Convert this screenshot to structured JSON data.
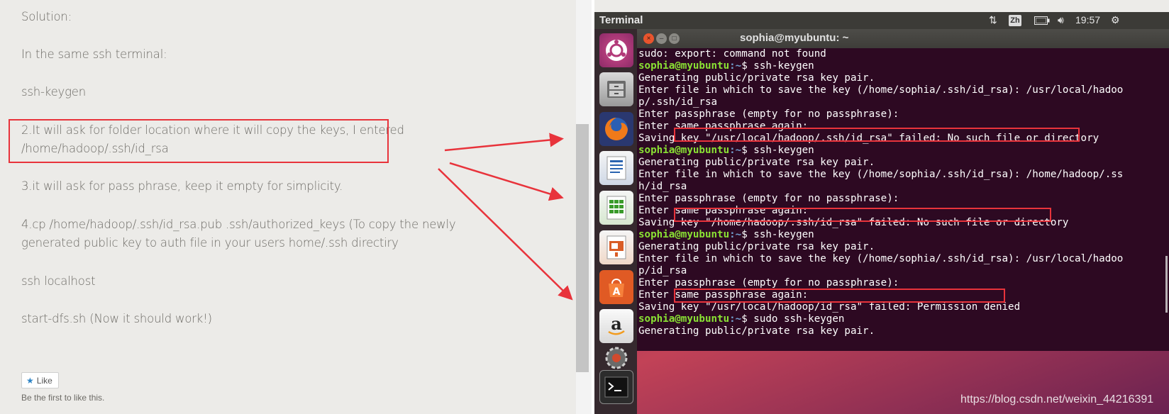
{
  "blog": {
    "lines": [
      "Solution:",
      "In the same ssh terminal:",
      "ssh-keygen",
      "2.It will ask for folder location where it will copy the keys, I entered",
      "/home/hadoop/.ssh/id_rsa",
      "3.it will ask for pass phrase, keep it empty for simplicity.",
      "4.cp /home/hadoop/.ssh/id_rsa.pub .ssh/authorized_keys (To copy the newly",
      "generated public key to auth file in your users home/.ssh directiry",
      "ssh localhost",
      "start-dfs.sh (Now it should work!)"
    ],
    "like_label": "Like",
    "like_note": "Be the first to like this."
  },
  "topbar": {
    "title": "Terminal",
    "lang": "Zh",
    "time": "19:57"
  },
  "launcher_icons": [
    "ubuntu-dash-icon",
    "files-icon",
    "firefox-icon",
    "writer-icon",
    "calc-icon",
    "impress-icon",
    "software-center-icon",
    "amazon-icon",
    "settings-icon",
    "terminal-icon"
  ],
  "terminal": {
    "title": "sophia@myubuntu: ~",
    "prompt_user": "sophia@myubuntu",
    "prompt_path": ":~",
    "lines": [
      {
        "t": "sudo: export: command not found"
      },
      {
        "p": true,
        "t": "$ ssh-keygen"
      },
      {
        "t": "Generating public/private rsa key pair."
      },
      {
        "t": "Enter file in which to save the key (/home/sophia/.ssh/id_rsa): /usr/local/hadoo"
      },
      {
        "t": "p/.ssh/id_rsa"
      },
      {
        "t": "Enter passphrase (empty for no passphrase):"
      },
      {
        "t": "Enter same passphrase again:"
      },
      {
        "t": "Saving key \"/usr/local/hadoop/.ssh/id_rsa\" failed: No such file or directory"
      },
      {
        "p": true,
        "t": "$ ssh-keygen"
      },
      {
        "t": "Generating public/private rsa key pair."
      },
      {
        "t": "Enter file in which to save the key (/home/sophia/.ssh/id_rsa): /home/hadoop/.ss"
      },
      {
        "t": "h/id_rsa"
      },
      {
        "t": "Enter passphrase (empty for no passphrase):"
      },
      {
        "t": "Enter same passphrase again:"
      },
      {
        "t": "Saving key \"/home/hadoop/.ssh/id_rsa\" failed: No such file or directory"
      },
      {
        "p": true,
        "t": "$ ssh-keygen"
      },
      {
        "t": "Generating public/private rsa key pair."
      },
      {
        "t": "Enter file in which to save the key (/home/sophia/.ssh/id_rsa): /usr/local/hadoo"
      },
      {
        "t": "p/id_rsa"
      },
      {
        "t": "Enter passphrase (empty for no passphrase):"
      },
      {
        "t": "Enter same passphrase again:"
      },
      {
        "t": "Saving key \"/usr/local/hadoop/id_rsa\" failed: Permission denied"
      },
      {
        "p": true,
        "t": "$ sudo ssh-keygen"
      },
      {
        "t": "Generating public/private rsa key pair."
      }
    ]
  },
  "watermark": "https://blog.csdn.net/weixin_44216391",
  "colors": {
    "annotation_red": "#e8333b",
    "terminal_bg": "#2d0922",
    "prompt_green": "#8ae234",
    "prompt_blue": "#729fcf"
  }
}
